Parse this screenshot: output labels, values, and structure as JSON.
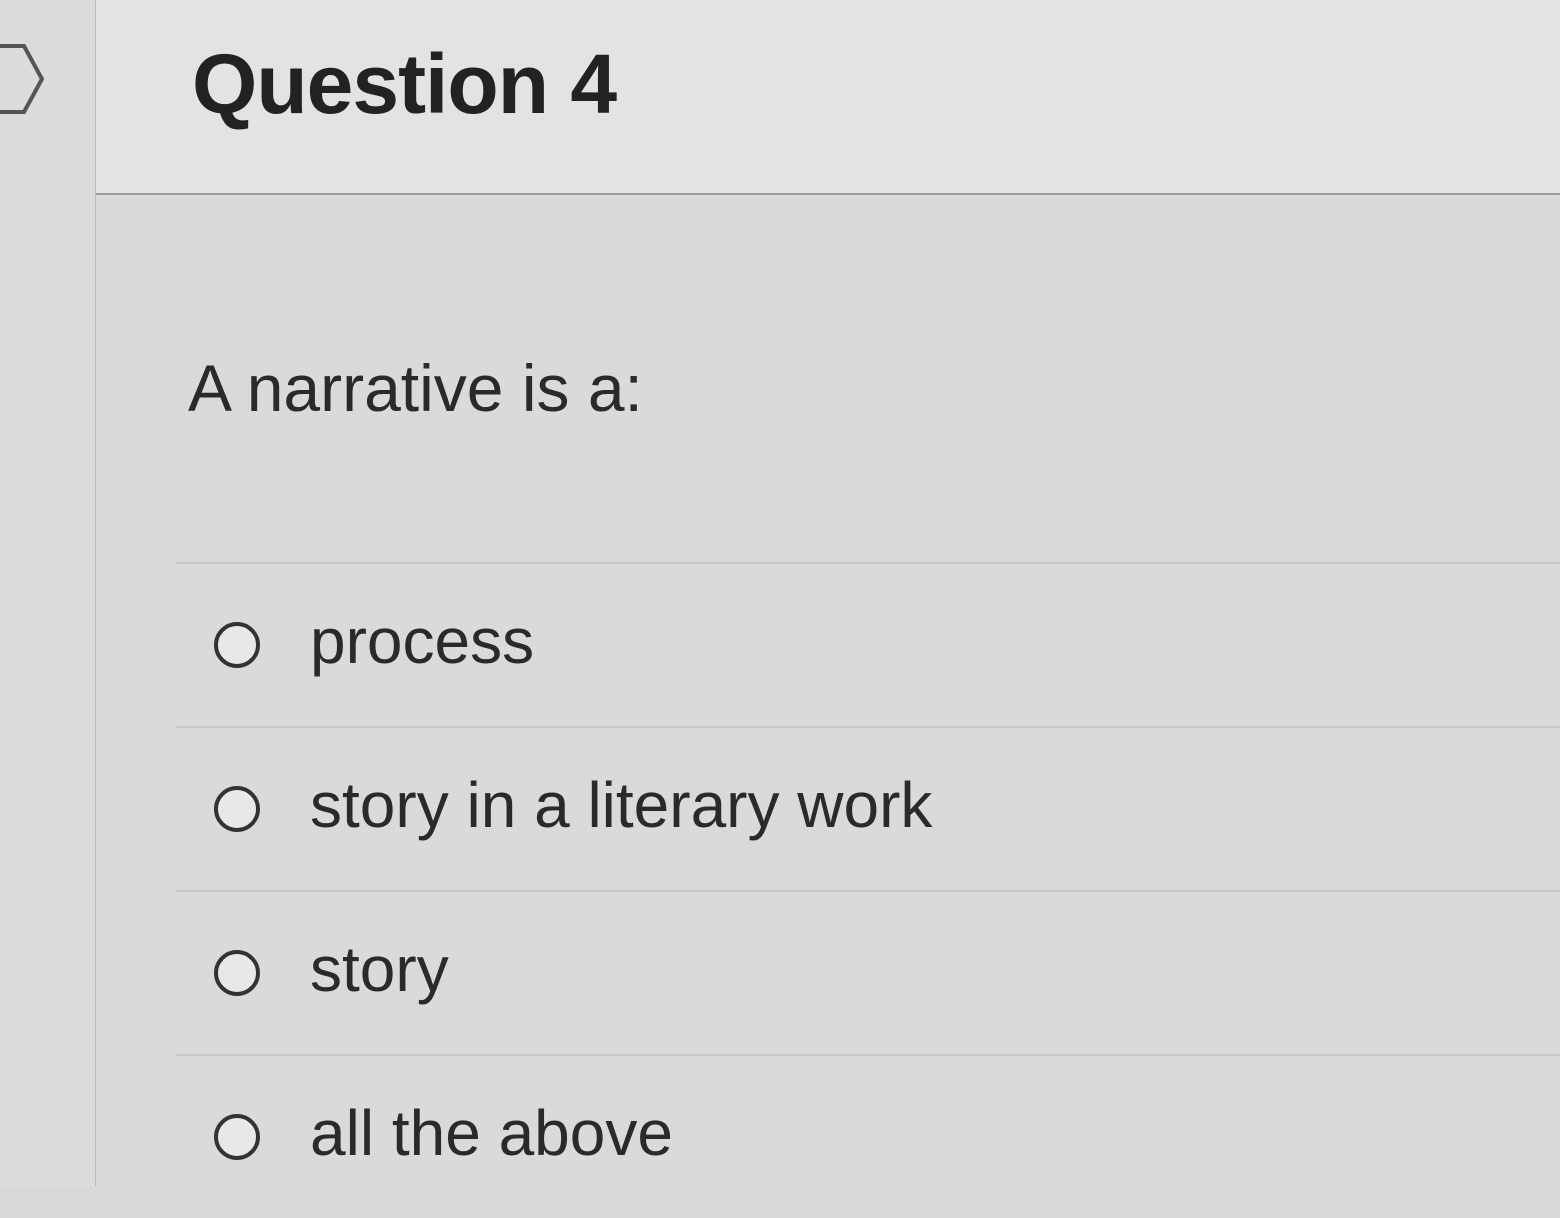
{
  "question": {
    "title": "Question 4",
    "text": "A narrative is a:"
  },
  "answers": [
    {
      "label": "process",
      "selected": false
    },
    {
      "label": "story in a literary work",
      "selected": false
    },
    {
      "label": "story",
      "selected": false
    },
    {
      "label": "all the above",
      "selected": false
    }
  ],
  "colors": {
    "background": "#dadada",
    "header_background": "#e3e3e3",
    "text": "#2a2a2a"
  }
}
